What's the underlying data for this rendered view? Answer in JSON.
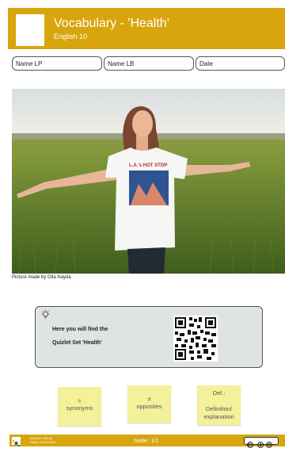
{
  "header": {
    "title": "Vocabulary - 'Health'",
    "subtitle": "English   10"
  },
  "fields": {
    "name_lp": "Name LP",
    "name_lb": "Name LB",
    "date": "Date"
  },
  "photo": {
    "caption": "Picture made by Olia Nayda",
    "shirt_text": "L.A.'s HOT STOP"
  },
  "quizlet": {
    "line1": "Here you will find the",
    "line2": "Quizlet Set 'Health'"
  },
  "notes": {
    "synonyms_symbol": "=",
    "synonyms": "synonyms",
    "opposites_symbol": "≠",
    "opposites": "opposites",
    "def": "Def.:",
    "def_line1": "Definition/",
    "def_line2": "explanation"
  },
  "footer": {
    "author_line1": "Autor/in: Gierali",
    "author_line2": "Stand: 23.09.2020",
    "page": "Seite: 1/1"
  },
  "colors": {
    "accent": "#d8a50c",
    "note": "#f5f19a",
    "panel": "#dfe3e3"
  },
  "icons": {
    "idea": "lightbulb-icon",
    "license": "cc-by-icon"
  }
}
